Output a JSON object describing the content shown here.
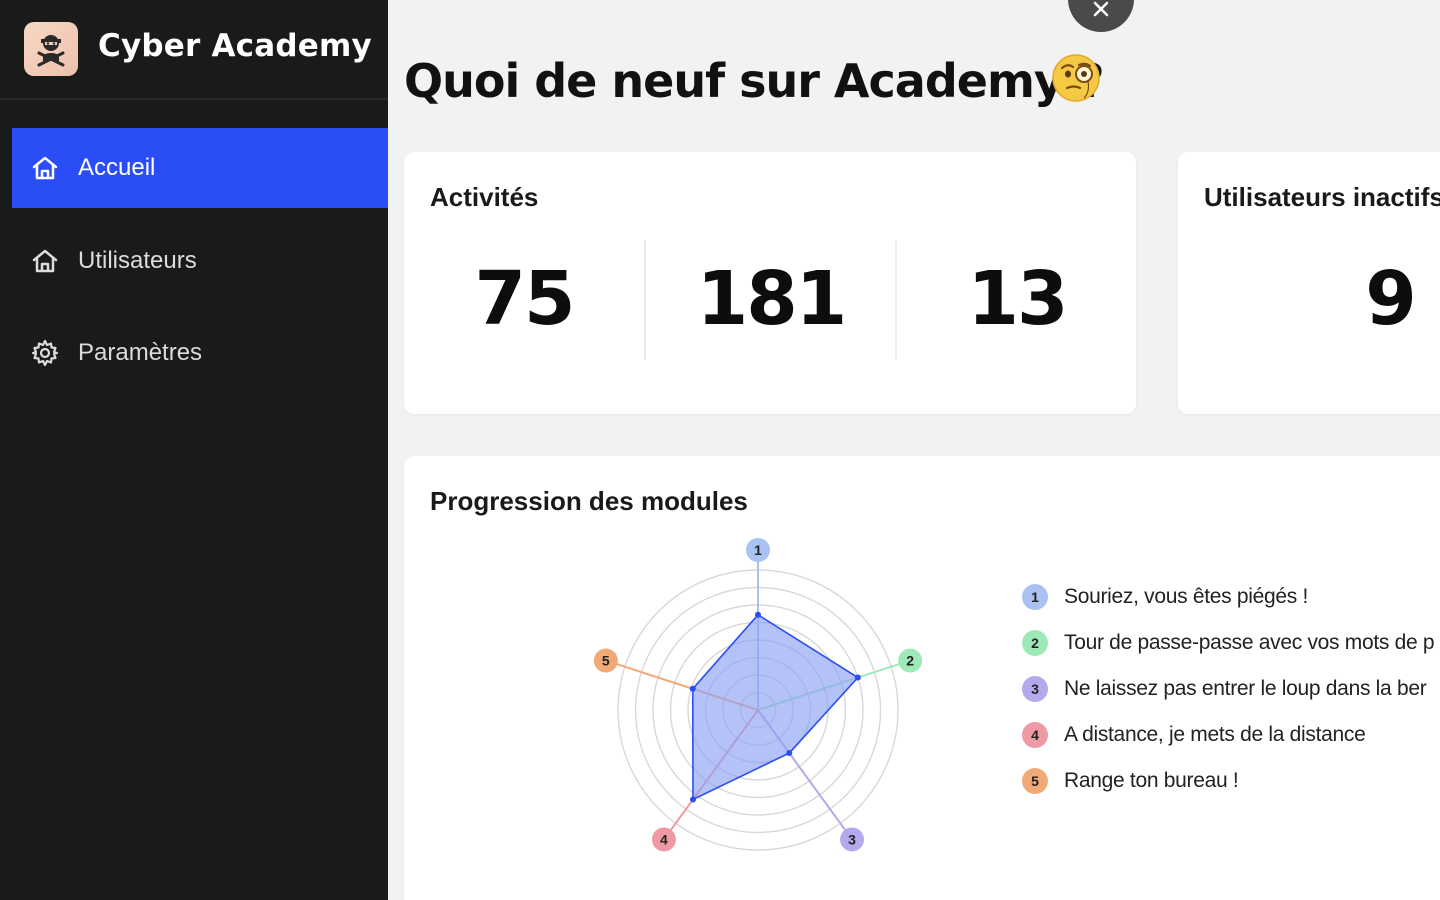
{
  "app": {
    "name": "Cyber Academy"
  },
  "sidebar": {
    "items": [
      {
        "label": "Accueil",
        "icon": "home-icon",
        "active": true
      },
      {
        "label": "Utilisateurs",
        "icon": "home-icon",
        "active": false
      },
      {
        "label": "Paramètres",
        "icon": "gear-icon",
        "active": false
      }
    ]
  },
  "main": {
    "title": "Quoi de neuf sur Academy ?",
    "title_emoji": "face-with-monocle-emoji",
    "activities_card": {
      "title": "Activités",
      "values": [
        "75",
        "181",
        "13"
      ]
    },
    "inactive_card": {
      "title": "Utilisateurs inactifs",
      "value": "9"
    },
    "progress_card": {
      "title": "Progression des modules",
      "modules": [
        {
          "number": "1",
          "label": "Souriez, vous êtes piégés !",
          "color": "#a9c2f2"
        },
        {
          "number": "2",
          "label": "Tour de passe-passe avec vos mots de p",
          "color": "#9fe8b8"
        },
        {
          "number": "3",
          "label": "Ne laissez pas entrer le loup dans la ber",
          "color": "#b6a8ec"
        },
        {
          "number": "4",
          "label": "A distance, je mets de la distance",
          "color": "#ee9aa4"
        },
        {
          "number": "5",
          "label": "Range ton bureau !",
          "color": "#f2a978"
        }
      ]
    }
  },
  "colors": {
    "sidebar_bg": "#1a1a1a",
    "accent": "#2b4df5",
    "radar_fill": "#8ea2f5",
    "radar_stroke": "#2b4df5"
  },
  "chart_data": {
    "type": "radar",
    "categories": [
      "1",
      "2",
      "3",
      "4",
      "5"
    ],
    "values": [
      0.68,
      0.75,
      0.38,
      0.79,
      0.49
    ],
    "rlim": [
      0,
      1
    ]
  }
}
